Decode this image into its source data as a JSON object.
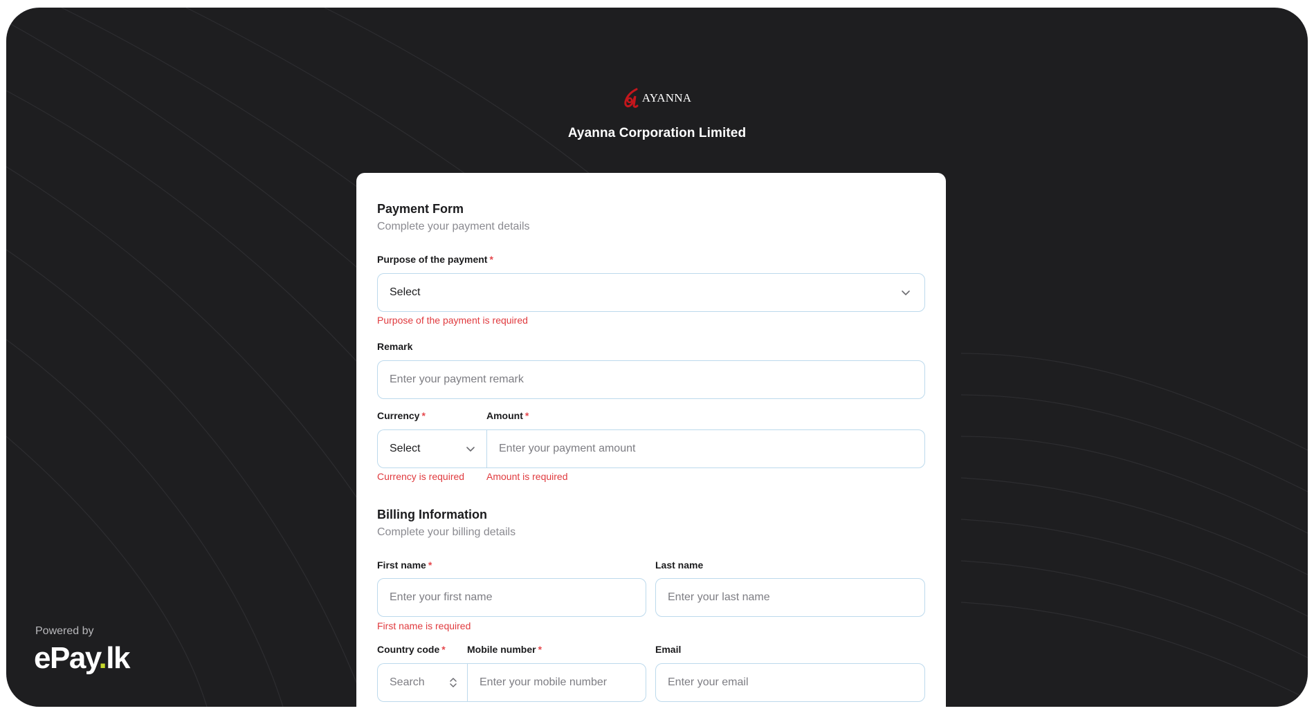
{
  "brand": {
    "logo_text": "AYANNA",
    "company": "Ayanna Corporation Limited",
    "accent_color": "#c4161c"
  },
  "footer": {
    "powered_by": "Powered by",
    "epay_main": "ePay",
    "epay_dot": ".",
    "epay_tld": "lk"
  },
  "payment": {
    "title": "Payment Form",
    "subtitle": "Complete your payment details",
    "purpose_label": "Purpose of the payment",
    "purpose_value": "Select",
    "purpose_error": "Purpose of the payment is required",
    "remark_label": "Remark",
    "remark_placeholder": "Enter your payment remark",
    "currency_label": "Currency",
    "currency_value": "Select",
    "currency_error": "Currency is required",
    "amount_label": "Amount",
    "amount_placeholder": "Enter your payment amount",
    "amount_error": "Amount is required",
    "required_mark": "*"
  },
  "billing": {
    "title": "Billing Information",
    "subtitle": "Complete your billing details",
    "first_name_label": "First name",
    "first_name_placeholder": "Enter your first name",
    "first_name_error": "First name is required",
    "last_name_label": "Last name",
    "last_name_placeholder": "Enter your last name",
    "country_code_label": "Country code",
    "country_code_placeholder": "Search",
    "mobile_label": "Mobile number",
    "mobile_placeholder": "Enter your mobile number",
    "email_label": "Email",
    "email_placeholder": "Enter your email"
  },
  "colors": {
    "background": "#1e1e20",
    "field_border": "#bcd9ec",
    "error": "#e03a3e",
    "epay_dot": "#c6d82b"
  }
}
